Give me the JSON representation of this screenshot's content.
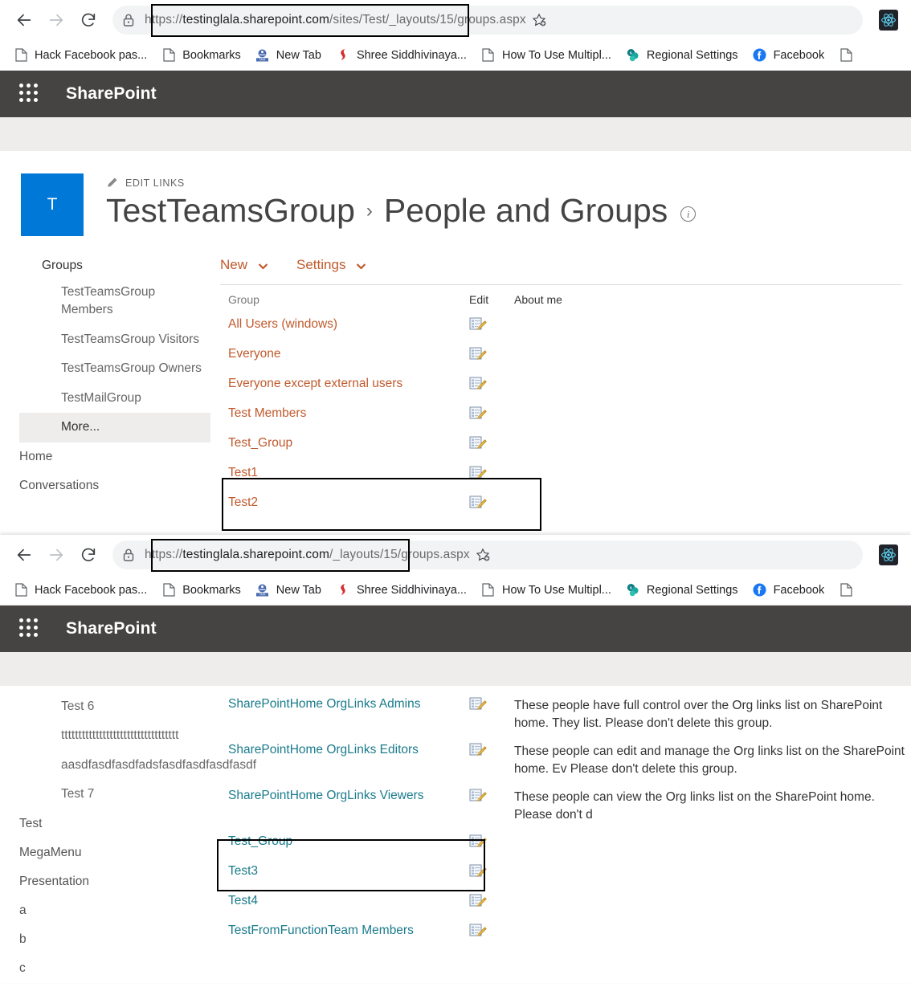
{
  "windows": [
    {
      "id": "top",
      "browser": {
        "back_tooltip": "Back",
        "forward_tooltip": "Forward",
        "reload_tooltip": "Reload",
        "url_full": "https://testinglala.sharepoint.com/sites/Test/_layouts/15/groups.aspx",
        "url_scheme": "https://",
        "url_host": "testinglala.sharepoint.com",
        "url_path": "/sites/Test/_layouts/15/groups.aspx",
        "bookmark_star": "star-add",
        "extension": "react-devtools"
      },
      "bookmarks": [
        {
          "label": "Hack Facebook pas...",
          "icon": "page-icon"
        },
        {
          "label": "Bookmarks",
          "icon": "page-icon"
        },
        {
          "label": "New Tab",
          "icon": "tata-icon"
        },
        {
          "label": "Shree Siddhivinaya...",
          "icon": "shree-icon"
        },
        {
          "label": "How To Use Multipl...",
          "icon": "page-icon"
        },
        {
          "label": "Regional Settings",
          "icon": "sharepoint-icon"
        },
        {
          "label": "Facebook",
          "icon": "facebook-icon"
        },
        {
          "label": "",
          "icon": "page-icon"
        }
      ],
      "suitebar": {
        "brand": "SharePoint",
        "waffle": "app-launcher-icon"
      },
      "site": {
        "logo_letter": "T",
        "edit_links": "EDIT LINKS",
        "title_primary": "TestTeamsGroup",
        "separator": "›",
        "title_secondary": "People and Groups",
        "info": "i"
      },
      "quicklaunch": {
        "header": "Groups",
        "sub_items": [
          {
            "label": "TestTeamsGroup Members",
            "selected": false
          },
          {
            "label": "TestTeamsGroup Visitors",
            "selected": false
          },
          {
            "label": "TestTeamsGroup Owners",
            "selected": false
          },
          {
            "label": "TestMailGroup",
            "selected": false
          },
          {
            "label": "More...",
            "selected": true
          }
        ],
        "root_items": [
          {
            "label": "Home"
          },
          {
            "label": "Conversations"
          }
        ]
      },
      "commands": [
        {
          "label": "New",
          "has_caret": true
        },
        {
          "label": "Settings",
          "has_caret": true
        }
      ],
      "table": {
        "columns": [
          "Group",
          "Edit",
          "About me"
        ],
        "rows": [
          {
            "group": "All Users (windows)",
            "edit": "edit-icon",
            "about": ""
          },
          {
            "group": "Everyone",
            "edit": "edit-icon",
            "about": ""
          },
          {
            "group": "Everyone except external users",
            "edit": "edit-icon",
            "about": ""
          },
          {
            "group": "Test Members",
            "edit": "edit-icon",
            "about": ""
          },
          {
            "group": "Test_Group",
            "edit": "edit-icon",
            "about": ""
          },
          {
            "group": "Test1",
            "edit": "edit-icon",
            "about": "",
            "highlighted": true
          },
          {
            "group": "Test2",
            "edit": "edit-icon",
            "about": "",
            "highlighted": true
          }
        ]
      }
    },
    {
      "id": "bottom",
      "browser": {
        "back_tooltip": "Back",
        "forward_tooltip": "Forward",
        "reload_tooltip": "Reload",
        "url_full": "https://testinglala.sharepoint.com/_layouts/15/groups.aspx",
        "url_scheme": "https://",
        "url_host": "testinglala.sharepoint.com",
        "url_path": "/_layouts/15/groups.aspx",
        "bookmark_star": "star-add",
        "extension": "react-devtools"
      },
      "bookmarks": [
        {
          "label": "Hack Facebook pas...",
          "icon": "page-icon"
        },
        {
          "label": "Bookmarks",
          "icon": "page-icon"
        },
        {
          "label": "New Tab",
          "icon": "tata-icon"
        },
        {
          "label": "Shree Siddhivinaya...",
          "icon": "shree-icon"
        },
        {
          "label": "How To Use Multipl...",
          "icon": "page-icon"
        },
        {
          "label": "Regional Settings",
          "icon": "sharepoint-icon"
        },
        {
          "label": "Facebook",
          "icon": "facebook-icon"
        },
        {
          "label": "",
          "icon": "page-icon"
        }
      ],
      "suitebar": {
        "brand": "SharePoint",
        "waffle": "app-launcher-icon"
      },
      "quicklaunch": {
        "sub_items": [
          {
            "label": "Test 6"
          },
          {
            "label": "tttttttttttttttttttttttttttttttttt"
          },
          {
            "label": "aasdfasdfasdfadsfasdfasdfasdfasdf"
          },
          {
            "label": "Test 7"
          }
        ],
        "root_items": [
          {
            "label": "Test"
          },
          {
            "label": "MegaMenu"
          },
          {
            "label": "Presentation"
          },
          {
            "label": "a"
          },
          {
            "label": "b"
          },
          {
            "label": "c"
          }
        ]
      },
      "table": {
        "rows": [
          {
            "group": "SharePointHome OrgLinks Admins",
            "edit": "edit-icon",
            "about": "These people have full control over the Org links list on SharePoint home. They list. Please don't delete this group."
          },
          {
            "group": "SharePointHome OrgLinks Editors",
            "edit": "edit-icon",
            "about": "These people can edit and manage the Org links list on the SharePoint home. Ev Please don't delete this group."
          },
          {
            "group": "SharePointHome OrgLinks Viewers",
            "edit": "edit-icon",
            "about": "These people can view the Org links list on the SharePoint home. Please don't d"
          },
          {
            "group": "Test_Group",
            "edit": "edit-icon",
            "about": ""
          },
          {
            "group": "Test3",
            "edit": "edit-icon",
            "about": "",
            "highlighted": true
          },
          {
            "group": "Test4",
            "edit": "edit-icon",
            "about": "",
            "highlighted": true
          },
          {
            "group": "TestFromFunctionTeam Members",
            "edit": "edit-icon",
            "about": ""
          }
        ]
      }
    }
  ],
  "colors": {
    "suitebar_bg": "#464442",
    "site_logo_bg": "#0078d7",
    "link_orange": "#c05a2d",
    "link_teal": "#1a7b8c",
    "band_gray": "#eeedec",
    "highlight_border": "#000000"
  }
}
